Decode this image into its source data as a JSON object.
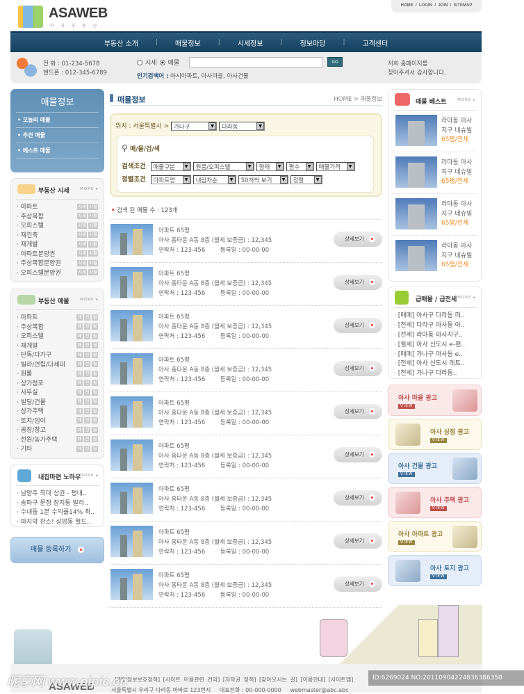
{
  "header": {
    "logo": "ASAWEB",
    "logo_sub": "아 사 부 동 산",
    "top_links": [
      "HOME",
      "LOGIN",
      "JOIN",
      "SITEMAP"
    ],
    "nav": [
      "부동산 소개",
      "매물정보",
      "시세정보",
      "정보마당",
      "고객센터"
    ]
  },
  "infobar": {
    "phone": "전    화 : 01-234-5678",
    "mobile": "핸드폰 : 012-345-6789",
    "radio_options": [
      "시세",
      "매물"
    ],
    "radio_selected": "매물",
    "search_value": "",
    "go_label": "GO",
    "popular_label": "인기검색어 :",
    "popular_terms": "아시아파트, 아사마을, 아사건물",
    "thanks_line1": "저희 홈페이지를",
    "thanks_line2": "찾아주셔서 감사합니다."
  },
  "left_menu": {
    "title": "매물정보",
    "items": [
      "오늘의 매물",
      "추천 매물",
      "베스트 매물"
    ]
  },
  "price_box": {
    "title": "부동산 시세",
    "more": "MORE",
    "tag1": "시세",
    "tag2": "시황",
    "items": [
      "아파트",
      "주상복합",
      "오피스텔",
      "재건축",
      "재개발",
      "아파트분양권",
      "주상복합분양권",
      "오피스텔분양권"
    ]
  },
  "listing_box": {
    "title": "부동산 매물",
    "more": "MORE",
    "tags": [
      "매",
      "전",
      "월"
    ],
    "items": [
      "아파트",
      "주상복합",
      "오피스텔",
      "재개발",
      "단독/다가구",
      "빌라/연립/다세대",
      "원룸",
      "상가점포",
      "사무실",
      "빌딩/건물",
      "상가주택",
      "토지/임야",
      "공장/창고",
      "전원/농가주택",
      "기타"
    ]
  },
  "knowhow_box": {
    "title": "내집마련 노하우",
    "more": "MORE",
    "items": [
      "남양주 최대 상권 - 평내..",
      "송파구 문정 장지동 빌라..",
      "수내동 1분 수익률14% 최..",
      "마지막 찬스! 상암동 월드.."
    ]
  },
  "register_button": "매물 등록하기",
  "main": {
    "title": "매물정보",
    "breadcrumb": "HOME > 매물정보",
    "location_label": "위치 : 서울특별시 >",
    "district": "가나구",
    "dong": "다라동",
    "search_title": "매/물/검/색",
    "cond_label": "검색조건",
    "cond_selects": [
      "매물구분",
      "원룸/오피스텔",
      "형태",
      "평수",
      "매물가격"
    ],
    "sort_label": "정렬조건",
    "sort_selects": [
      "아파트명",
      "내림차순",
      "50개씩 보기",
      "정렬"
    ],
    "count_text": "검색 된 매물 수 : 123개",
    "detail_label": "상세보기",
    "listings": [
      {
        "title": "아파트 65평",
        "desc": "아사 홈타운 A동 8층 (월세 보증금) : 12,345",
        "contact": "연락처 : 123-456",
        "date": "등록일 : 00-00-00"
      },
      {
        "title": "아파트 65평",
        "desc": "아사 홈타운 A동 8층 (월세 보증금) : 12,345",
        "contact": "연락처 : 123-456",
        "date": "등록일 : 00-00-00"
      },
      {
        "title": "아파트 65평",
        "desc": "아사 홈타운 A동 8층 (월세 보증금) : 12,345",
        "contact": "연락처 : 123-456",
        "date": "등록일 : 00-00-00"
      },
      {
        "title": "아파트 65평",
        "desc": "아사 홈타운 A동 8층 (월세 보증금) : 12,345",
        "contact": "연락처 : 123-456",
        "date": "등록일 : 00-00-00"
      },
      {
        "title": "아파트 65평",
        "desc": "아사 홈타운 A동 8층 (월세 보증금) : 12,345",
        "contact": "연락처 : 123-456",
        "date": "등록일 : 00-00-00"
      },
      {
        "title": "아파트 65평",
        "desc": "아사 홈타운 A동 8층 (월세 보증금) : 12,345",
        "contact": "연락처 : 123-456",
        "date": "등록일 : 00-00-00"
      },
      {
        "title": "아파트 65평",
        "desc": "아사 홈타운 A동 8층 (월세 보증금) : 12,345",
        "contact": "연락처 : 123-456",
        "date": "등록일 : 00-00-00"
      },
      {
        "title": "아파트 65평",
        "desc": "아사 홈타운 A동 8층 (월세 보증금) : 12,345",
        "contact": "연락처 : 123-456",
        "date": "등록일 : 00-00-00"
      },
      {
        "title": "아파트 65평",
        "desc": "아사 홈타운 A동 8층 (월세 보증금) : 12,345",
        "contact": "연락처 : 123-456",
        "date": "등록일 : 00-00-00"
      }
    ]
  },
  "best_box": {
    "title": "매물 베스트",
    "more": "MORE",
    "items": [
      {
        "l1": "라마동 아사",
        "l2": "지구 네슈빌",
        "l3": "65평/전세"
      },
      {
        "l1": "라마동 아사",
        "l2": "지구 네슈빌",
        "l3": "65평/전세"
      },
      {
        "l1": "라마동 아사",
        "l2": "지구 네슈빌",
        "l3": "65평/전세"
      },
      {
        "l1": "라마동 아사",
        "l2": "지구 네슈빌",
        "l3": "65평/전세"
      }
    ]
  },
  "urgent_box": {
    "title": "급매물 / 급전세",
    "more": "MORE",
    "items": [
      "[매매] 아사구 다라동 미..",
      "[전세] 다라구 아사동 아..",
      "[전세] 라마동 아사지구..",
      "[월세] 아사 신도시 e-편..",
      "[매매] 가나구 아사동 e..",
      "[전세] 아사 신도시 레트..",
      "[전세] 가나구 다라동.."
    ]
  },
  "ads": [
    {
      "label": "아사 마을 광고",
      "view": "VIEW",
      "bg": "#fbe9ea",
      "border": "#f0c9cc",
      "color": "#c0504d"
    },
    {
      "label": "아사 상점 광고",
      "view": "VIEW",
      "bg": "#fcf8ea",
      "border": "#ece2be",
      "color": "#9a8440"
    },
    {
      "label": "아사 건물 광고",
      "view": "VIEW",
      "bg": "#e5eef8",
      "border": "#c5d6ea",
      "color": "#3f6f9c"
    },
    {
      "label": "아사 주택 광고",
      "view": "VIEW",
      "bg": "#fbe9ea",
      "border": "#f0c9cc",
      "color": "#c0504d"
    },
    {
      "label": "아사 아파트 광고",
      "view": "VIEW",
      "bg": "#fcf8ea",
      "border": "#ece2be",
      "color": "#9a8440"
    },
    {
      "label": "아사 토지 광고",
      "view": "VIEW",
      "bg": "#e5eef8",
      "border": "#c5d6ea",
      "color": "#3f6f9c"
    }
  ],
  "footer": {
    "logo": "ASAWEB",
    "links": [
      "[개인정보보호정책]",
      "[사이트 이용관련 건의]",
      "[저작권 정책]",
      "[찾아오시는 길]",
      "[이용안내]",
      "[사이트맵]"
    ],
    "address": "서울특별시 우리구 다라동 마바로 123번지",
    "tel": "대표전화 : 00-000-0000",
    "email": "webmaster@abc.abc"
  },
  "watermark": {
    "site": "昵享网 www.nipic.cn",
    "id": "ID:6269024 NO:20110904224836386350"
  }
}
